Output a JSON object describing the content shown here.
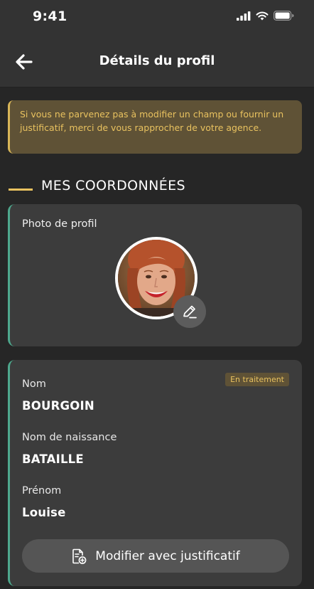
{
  "status_bar": {
    "time": "9:41"
  },
  "nav": {
    "title": "Détails du profil"
  },
  "alert": {
    "text": "Si vous ne parvenez pas à modifier un champ ou fournir un justificatif, merci de vous rapprocher de votre agence."
  },
  "section": {
    "title": "MES COORDONNÉES"
  },
  "photo_card": {
    "label": "Photo de profil"
  },
  "identity_card": {
    "badge": "En traitement",
    "fields": [
      {
        "label": "Nom",
        "value": "BOURGOIN"
      },
      {
        "label": "Nom de naissance",
        "value": "BATAILLE"
      },
      {
        "label": "Prénom",
        "value": "Louise"
      }
    ],
    "button_label": "Modifier avec justificatif"
  },
  "colors": {
    "background": "#262626",
    "card": "#3c3c3c",
    "accent_gold": "#e9c25f",
    "accent_green": "#4ea88d"
  },
  "icons": [
    "signal-icon",
    "wifi-icon",
    "battery-icon",
    "back-arrow-icon",
    "pencil-icon",
    "document-add-icon"
  ]
}
